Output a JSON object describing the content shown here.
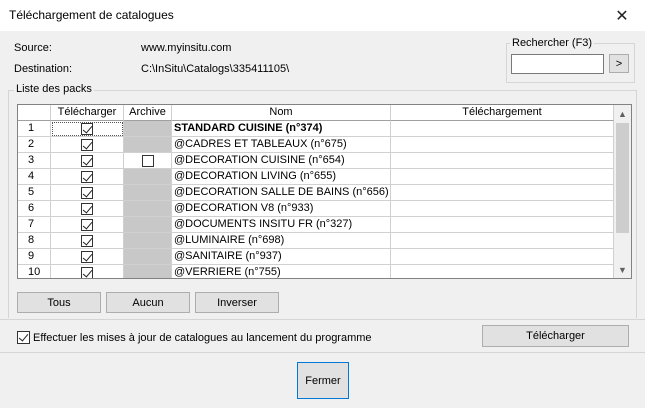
{
  "window": {
    "title": "Téléchargement de catalogues",
    "close_symbol": "✕"
  },
  "info": {
    "source_label": "Source:",
    "source_value": "www.myinsitu.com",
    "destination_label": "Destination:",
    "destination_value": "C:\\InSitu\\Catalogs\\335411105\\"
  },
  "search": {
    "label": "Rechercher (F3)",
    "value": "",
    "button_label": ">"
  },
  "packs": {
    "group_label": "Liste des packs",
    "columns": [
      "",
      "Télécharger",
      "Archive",
      "Nom",
      "Téléchargement"
    ],
    "rows": [
      {
        "index": "1",
        "download": true,
        "archive": null,
        "name": "STANDARD CUISINE (n°374)",
        "status": "",
        "bold": true
      },
      {
        "index": "2",
        "download": true,
        "archive": null,
        "name": "@CADRES ET TABLEAUX (n°675)",
        "status": ""
      },
      {
        "index": "3",
        "download": true,
        "archive": false,
        "name": "@DECORATION CUISINE (n°654)",
        "status": ""
      },
      {
        "index": "4",
        "download": true,
        "archive": null,
        "name": "@DECORATION LIVING (n°655)",
        "status": ""
      },
      {
        "index": "5",
        "download": true,
        "archive": null,
        "name": "@DECORATION SALLE DE BAINS (n°656)",
        "status": ""
      },
      {
        "index": "6",
        "download": true,
        "archive": null,
        "name": "@DECORATION V8 (n°933)",
        "status": ""
      },
      {
        "index": "7",
        "download": true,
        "archive": null,
        "name": "@DOCUMENTS INSITU FR (n°327)",
        "status": ""
      },
      {
        "index": "8",
        "download": true,
        "archive": null,
        "name": "@LUMINAIRE (n°698)",
        "status": ""
      },
      {
        "index": "9",
        "download": true,
        "archive": null,
        "name": "@SANITAIRE (n°937)",
        "status": ""
      },
      {
        "index": "10",
        "download": true,
        "archive": null,
        "name": "@VERRIERE (n°755)",
        "status": ""
      }
    ],
    "scroll_up": "▲",
    "scroll_down": "▼"
  },
  "selection_buttons": {
    "all": "Tous",
    "none": "Aucun",
    "invert": "Inverser"
  },
  "footer": {
    "auto_update_label": "Effectuer les mises à jour de catalogues au lancement du programme",
    "auto_update_checked": true,
    "download_button": "Télécharger",
    "close_button": "Fermer"
  }
}
